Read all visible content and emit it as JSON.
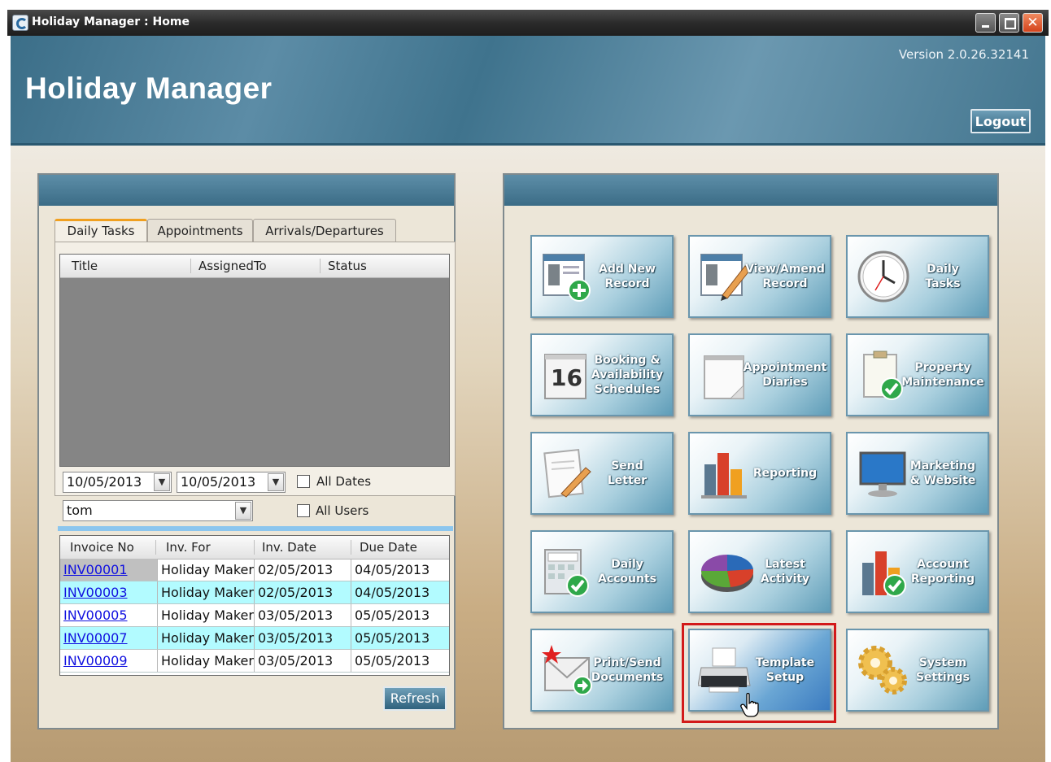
{
  "window": {
    "title": "Holiday Manager : Home"
  },
  "header": {
    "app_title": "Holiday Manager",
    "version": "Version 2.0.26.32141",
    "logout_label": "Logout"
  },
  "tasks_panel": {
    "tabs": [
      {
        "label": "Daily Tasks",
        "active": true
      },
      {
        "label": "Appointments",
        "active": false
      },
      {
        "label": "Arrivals/Departures",
        "active": false
      }
    ],
    "task_grid_columns": [
      "Title",
      "AssignedTo",
      "Status"
    ],
    "date_from": "10/05/2013",
    "date_to": "10/05/2013",
    "all_dates_label": "All Dates",
    "user": "tom",
    "all_users_label": "All Users"
  },
  "invoices": {
    "columns": [
      "Invoice No",
      "Inv. For",
      "Inv. Date",
      "Due Date"
    ],
    "rows": [
      [
        "INV00001",
        "Holiday Maker",
        "02/05/2013",
        "04/05/2013"
      ],
      [
        "INV00003",
        "Holiday Maker",
        "02/05/2013",
        "04/05/2013"
      ],
      [
        "INV00005",
        "Holiday Maker",
        "03/05/2013",
        "05/05/2013"
      ],
      [
        "INV00007",
        "Holiday Maker",
        "03/05/2013",
        "05/05/2013"
      ],
      [
        "INV00009",
        "Holiday Maker",
        "03/05/2013",
        "05/05/2013"
      ]
    ],
    "refresh_label": "Refresh"
  },
  "menu_tiles": [
    {
      "label": "Add New\nRecord",
      "icon": "add-record-icon"
    },
    {
      "label": "View/Amend\nRecord",
      "icon": "edit-record-icon"
    },
    {
      "label": "Daily\nTasks",
      "icon": "clock-icon"
    },
    {
      "label": "Booking &\nAvailability\nSchedules",
      "icon": "calendar-icon",
      "calendar_day": "16"
    },
    {
      "label": "Appointment\nDiaries",
      "icon": "notepad-icon"
    },
    {
      "label": "Property\nMaintenance",
      "icon": "clipboard-check-icon"
    },
    {
      "label": "Send\nLetter",
      "icon": "letter-pen-icon"
    },
    {
      "label": "Reporting",
      "icon": "bar-chart-icon"
    },
    {
      "label": "Marketing\n& Website",
      "icon": "monitor-icon"
    },
    {
      "label": "Daily\nAccounts",
      "icon": "calculator-check-icon"
    },
    {
      "label": "Latest\nActivity",
      "icon": "pie-chart-icon"
    },
    {
      "label": "Account\nReporting",
      "icon": "bar-chart-check-icon"
    },
    {
      "label": "Print/Send\nDocuments",
      "icon": "envelope-icon"
    },
    {
      "label": "Template\nSetup",
      "icon": "printer-icon",
      "selected": true
    },
    {
      "label": "System\nSettings",
      "icon": "gears-icon"
    }
  ],
  "colors": {
    "header_blue": "#3f738d",
    "tile_selected_outline": "#d21a1a",
    "invoice_alt_row": "#b2fbff",
    "link": "#1010e0"
  }
}
